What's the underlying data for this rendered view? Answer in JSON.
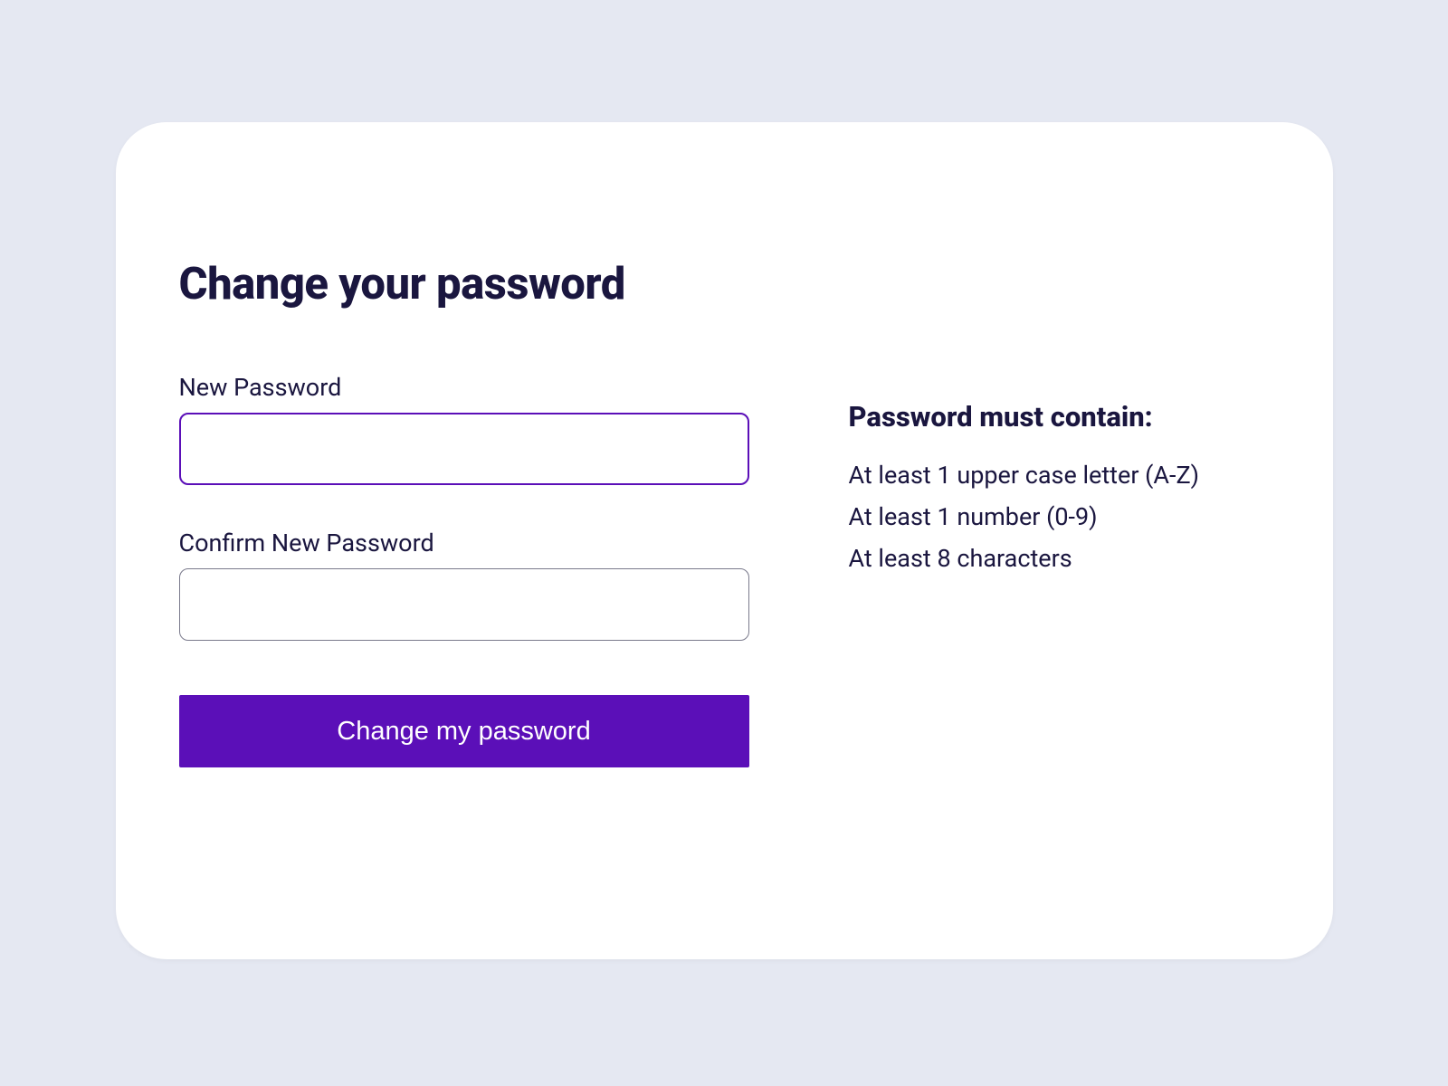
{
  "title": "Change your password",
  "form": {
    "new_password_label": "New Password",
    "new_password_value": "",
    "confirm_password_label": "Confirm New Password",
    "confirm_password_value": "",
    "submit_label": "Change my password"
  },
  "rules": {
    "heading": "Password must contain:",
    "items": [
      "At least 1 upper case letter (A-Z)",
      "At least 1 number (0-9)",
      "At least 8 characters"
    ]
  }
}
